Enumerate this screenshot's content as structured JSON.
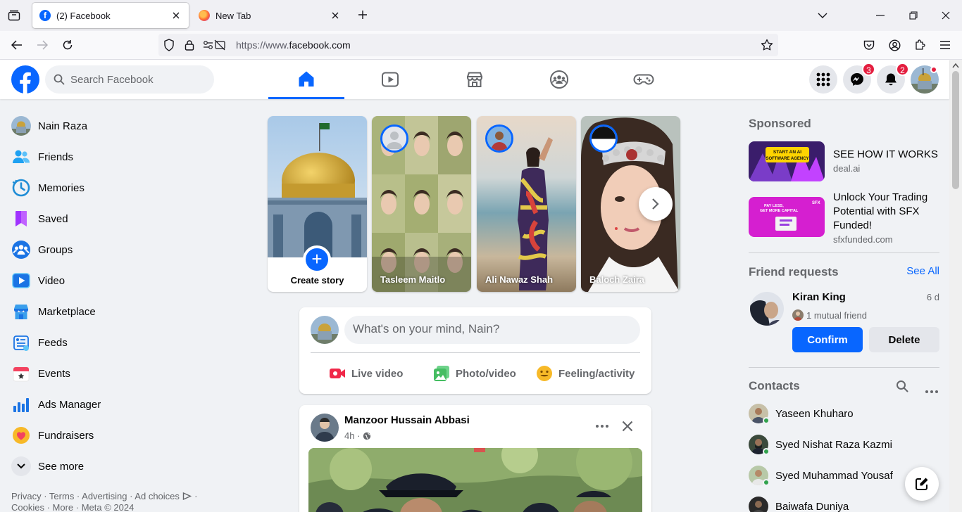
{
  "browser": {
    "tabs": [
      {
        "title": "(2) Facebook",
        "active": true
      },
      {
        "title": "New Tab",
        "active": false
      }
    ],
    "url_prefix": "https://www.",
    "url_domain": "facebook.com"
  },
  "header": {
    "search_placeholder": "Search Facebook",
    "nav_tabs": [
      "home",
      "video",
      "marketplace",
      "groups",
      "gaming"
    ],
    "messenger_badge": "3",
    "notifications_badge": "2"
  },
  "sidebar": {
    "items": [
      {
        "label": "Nain Raza",
        "icon": "profile-avatar"
      },
      {
        "label": "Friends",
        "icon": "friends-icon"
      },
      {
        "label": "Memories",
        "icon": "memories-icon"
      },
      {
        "label": "Saved",
        "icon": "saved-icon"
      },
      {
        "label": "Groups",
        "icon": "groups-icon"
      },
      {
        "label": "Video",
        "icon": "video-icon"
      },
      {
        "label": "Marketplace",
        "icon": "marketplace-icon"
      },
      {
        "label": "Feeds",
        "icon": "feeds-icon"
      },
      {
        "label": "Events",
        "icon": "events-icon"
      },
      {
        "label": "Ads Manager",
        "icon": "ads-manager-icon"
      },
      {
        "label": "Fundraisers",
        "icon": "fundraisers-icon"
      },
      {
        "label": "See more",
        "icon": "chevron-down-icon"
      }
    ],
    "footer_line1": "Privacy · Terms · Advertising · Ad choices",
    "footer_line2": "Cookies · More · Meta © 2024"
  },
  "stories": {
    "create_label": "Create story",
    "items": [
      {
        "name": "Tasleem Maitlo"
      },
      {
        "name": "Ali Nawaz Shah"
      },
      {
        "name": "Baloch Zaira"
      }
    ]
  },
  "composer": {
    "placeholder": "What's on your mind, Nain?",
    "actions": [
      "Live video",
      "Photo/video",
      "Feeling/activity"
    ]
  },
  "post": {
    "author": "Manzoor Hussain Abbasi",
    "time": "4h ·"
  },
  "right": {
    "sponsored_title": "Sponsored",
    "ads": [
      {
        "headline": "SEE HOW IT WORKS",
        "domain": "deal.ai",
        "image_text": "START AN AI SOFTWARE AGENCY"
      },
      {
        "headline": "Unlock Your Trading Potential with SFX Funded!",
        "domain": "sfxfunded.com",
        "image_text": "PAY LESS, GET MORE CAPITAL"
      }
    ],
    "friend_requests_title": "Friend requests",
    "see_all": "See All",
    "request": {
      "name": "Kiran King",
      "age": "6 d",
      "mutual": "1 mutual friend",
      "confirm": "Confirm",
      "delete": "Delete"
    },
    "contacts_title": "Contacts",
    "contacts": [
      "Yaseen Khuharo",
      "Syed Nishat Raza Kazmi",
      "Syed Muhammad Yousaf",
      "Baiwafa Duniya"
    ]
  },
  "colors": {
    "brand": "#0866ff",
    "badge": "#e41e3f",
    "online": "#31a24c"
  }
}
